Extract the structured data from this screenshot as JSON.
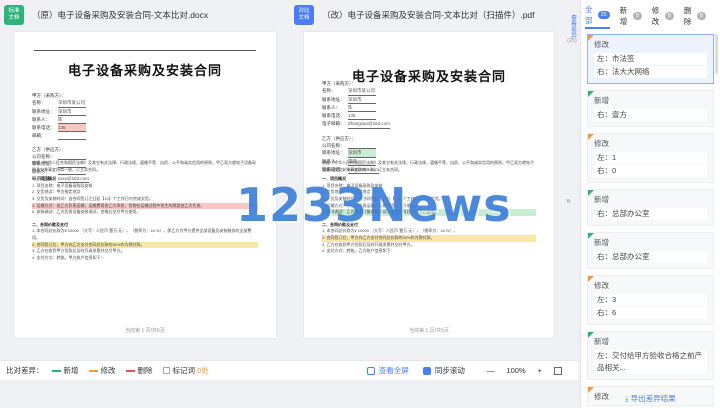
{
  "left_pane": {
    "badge": "标准\n文档",
    "file_name": "（原）电子设备采购及安装合同-文本比对.docx",
    "doc_title": "电子设备采购及安装合同",
    "party_a_label": "甲方（采购方）：",
    "fields": [
      {
        "label": "名称：",
        "value": "深圳市某公司"
      },
      {
        "label": "联系地址：",
        "value": "深圳市"
      },
      {
        "label": "联系人：",
        "value": "陈"
      },
      {
        "label": "联系电话：",
        "value": "135"
      },
      {
        "label": "邮箱：",
        "value": ""
      }
    ],
    "party_b_label": "乙方（供应方）：",
    "fields_b": [
      {
        "label": "公司名称：",
        "value": ""
      },
      {
        "label": "联系地址：",
        "value": ""
      },
      {
        "label": "联系人：",
        "value": ""
      },
      {
        "label": "联系电话：",
        "value": "xxxx@163.com"
      }
    ],
    "intro": "依据《中华人民共和国民法典》及其它有关法律、行政法规，遵循平等、自愿、公平和诚实信用的原则，甲乙双方就电子设备采购及安装事宜协商一致，订立本合同。",
    "section1": "一、项目概况",
    "section1_lines": [
      "1. 项目名称：电子设备采购及安装",
      "2. 交货地点：甲方指定地点",
      "3. 交货及安装时间：自合同签订之日起【10】个工作日内完成交货。",
      "4. 运输方式：由乙方负责运输，运输费用由乙方承担，货物在运输过程中发生的损毁由乙方负责。",
      "5. 安装调试：乙方负责设备安装调试，合格后交付甲方使用。"
    ],
    "section2": "二、合同价款及支付",
    "section2_lines": [
      "1. 本合同总价款为¥ 10000 （大写：人民币 壹万 元），（税率为：16 %），即乙方为甲方提供全部设备及安装服务的全部费用。",
      "2. 合同签订后，甲方向乙方支付合同总价款的30%作为预付款。",
      "3. 乙方在收到甲方货款后及时开具发票并交付甲方。",
      "4. 支付方式：转账。甲方账户信息如下："
    ],
    "page_num": "当前第 1 页/共5页"
  },
  "right_pane": {
    "badge": "对比\n文档",
    "file_name": "（改）电子设备采购及安装合同-文本比对（扫描件）.pdf",
    "doc_title": "电子设备采购及安装合同",
    "party_a_label": "甲方（采购方）：",
    "fields": [
      {
        "label": "名称：",
        "value": "深圳市某公司"
      },
      {
        "label": "联系地址：",
        "value": "深圳市"
      },
      {
        "label": "联系人：",
        "value": "陈"
      },
      {
        "label": "联系电话：",
        "value": "135"
      },
      {
        "label": "电子邮箱：",
        "value": "Zhangsan@163.com"
      }
    ],
    "party_b_label": "乙方（供应方）：",
    "fields_b": [
      {
        "label": "公司名称：",
        "value": ""
      },
      {
        "label": "联系地址：",
        "value": "深圳市"
      },
      {
        "label": "联系人：",
        "value": "李四"
      },
      {
        "label": "联系电话：",
        "value": "xxxx@163.com"
      }
    ],
    "intro": "依据《中华人民共和国民法典》及其它有关法律、行政法规，遵循平等、自愿、公平和诚实信用的原则，甲乙双方就电子设备采购及安装事宜协商一致，订立本合同。",
    "section1": "一、项目概况",
    "section1_lines": [
      "1. 项目名称：电子设备采购及安装",
      "2. 交货地点：甲方指定地点",
      "3. 交货及安装时间：自合同签订之日起【10】个工作日内完成交货。",
      "4. 运输方式：由乙方负责运输，运输费用由乙方承担。",
      "5. 安装调试：乙方负责设备安装调试，验收合格后交付甲方使用。"
    ],
    "section2": "二、合同价款及支付",
    "section2_lines": [
      "1. 本合同总价款为¥ 10000 （大写：人民币 壹万 元），（税率为：16 %）。",
      "2. 合同签订后，甲方向乙方支付合同总价款的30%作为预付款。",
      "3. 乙方在收到甲方货款后及时开具发票并交付甲方。",
      "4. 支付方式：转账。乙方账户信息如下："
    ],
    "page_num": "当前第 1 页/共5页"
  },
  "vertical_tab": {
    "label": "查看差异",
    "count": "(25)"
  },
  "watermark": "1233News",
  "bottom_bar": {
    "label": "比对差异：",
    "legend": [
      {
        "name": "新增",
        "color": "#2fb37a"
      },
      {
        "name": "修改",
        "color": "#f29b38"
      },
      {
        "name": "删除",
        "color": "#e5534b"
      }
    ],
    "keyword_label": "标记词",
    "keyword_count": "0",
    "keyword_unit": "处",
    "view_all": "查看全屏",
    "sync_scroll": "同步滚动",
    "zoom_minus": "—",
    "zoom_value": "100%",
    "zoom_plus": "+"
  },
  "side_panel": {
    "tabs": [
      {
        "label": "全部",
        "count": "25",
        "active": true
      },
      {
        "label": "新增",
        "count": "9"
      },
      {
        "label": "修改",
        "count": "8"
      },
      {
        "label": "删除",
        "count": "8"
      }
    ],
    "items": [
      {
        "title": "修改",
        "lines": [
          "左：市法签",
          "右：法大大网络"
        ],
        "type": "edit"
      },
      {
        "title": "新增",
        "lines": [
          "右：壹方"
        ],
        "type": "add"
      },
      {
        "title": "修改",
        "lines": [
          "左：1",
          "右：0"
        ],
        "type": "edit"
      },
      {
        "title": "新增",
        "lines": [
          "右：总部办公室"
        ],
        "type": "add"
      },
      {
        "title": "新增",
        "lines": [
          "右：总部办公室"
        ],
        "type": "add"
      },
      {
        "title": "修改",
        "lines": [
          "左：3",
          "右：6"
        ],
        "type": "edit"
      },
      {
        "title": "新增",
        "lines": [
          "左：交付给甲方验收合格之前产品相关..."
        ],
        "type": "add"
      },
      {
        "title": "修改",
        "lines": [
          "左："
        ],
        "type": "edit"
      }
    ],
    "export_label": "导出差异结果"
  }
}
